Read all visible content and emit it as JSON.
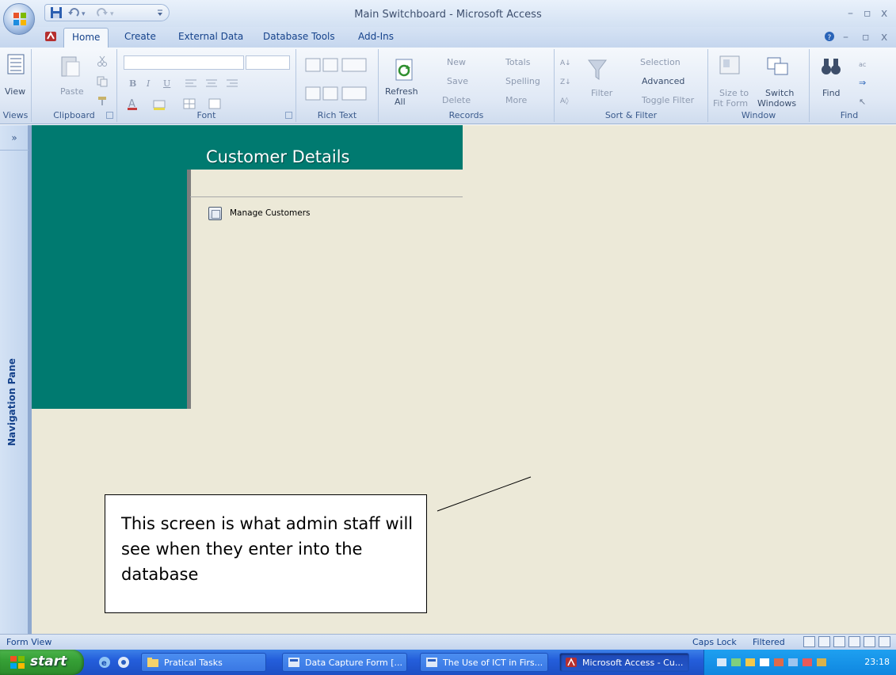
{
  "window": {
    "title": "Main Switchboard - Microsoft Access",
    "minimize": "–",
    "maximize": "▫",
    "close": "x"
  },
  "tabs": [
    {
      "label": "Home",
      "active": true
    },
    {
      "label": "Create"
    },
    {
      "label": "External Data"
    },
    {
      "label": "Database Tools"
    },
    {
      "label": "Add-Ins"
    }
  ],
  "ribbon": {
    "views": {
      "group": "Views",
      "view": "View"
    },
    "clipboard": {
      "group": "Clipboard",
      "paste": "Paste"
    },
    "font": {
      "group": "Font",
      "bold": "B",
      "italic": "I",
      "underline": "U"
    },
    "rich_text": {
      "group": "Rich Text"
    },
    "records": {
      "group": "Records",
      "refresh": "Refresh",
      "refresh_all": "All",
      "new": "New",
      "save": "Save",
      "delete": "Delete",
      "totals": "Totals",
      "spelling": "Spelling",
      "more": "More"
    },
    "sort_filter": {
      "group": "Sort & Filter",
      "filter": "Filter",
      "selection": "Selection",
      "advanced": "Advanced",
      "toggle_filter": "Toggle Filter"
    },
    "window_group": {
      "group": "Window",
      "size_to": "Size to",
      "fit_form": "Fit Form",
      "switch": "Switch",
      "windows": "Windows"
    },
    "find": {
      "group": "Find",
      "find": "Find"
    }
  },
  "nav_pane": {
    "collapse": "»",
    "label": "Navigation Pane"
  },
  "form": {
    "title": "Customer Details",
    "items": [
      {
        "label": "Manage Customers"
      }
    ]
  },
  "callout": {
    "text": "This screen is what admin staff will see when they enter into the database"
  },
  "status": {
    "left": "Form View",
    "caps": "Caps Lock",
    "filtered": "Filtered"
  },
  "taskbar": {
    "start": "start",
    "tasks": [
      {
        "label": "Pratical Tasks"
      },
      {
        "label": "Data Capture Form [..."
      },
      {
        "label": "The Use of ICT in Firs..."
      },
      {
        "label": "Microsoft Access - Cu..."
      }
    ],
    "clock": "23:18"
  },
  "colors": {
    "form_teal": "#007a70",
    "work_bg": "#ece9d8",
    "ribbon_blue": "#15428b"
  }
}
